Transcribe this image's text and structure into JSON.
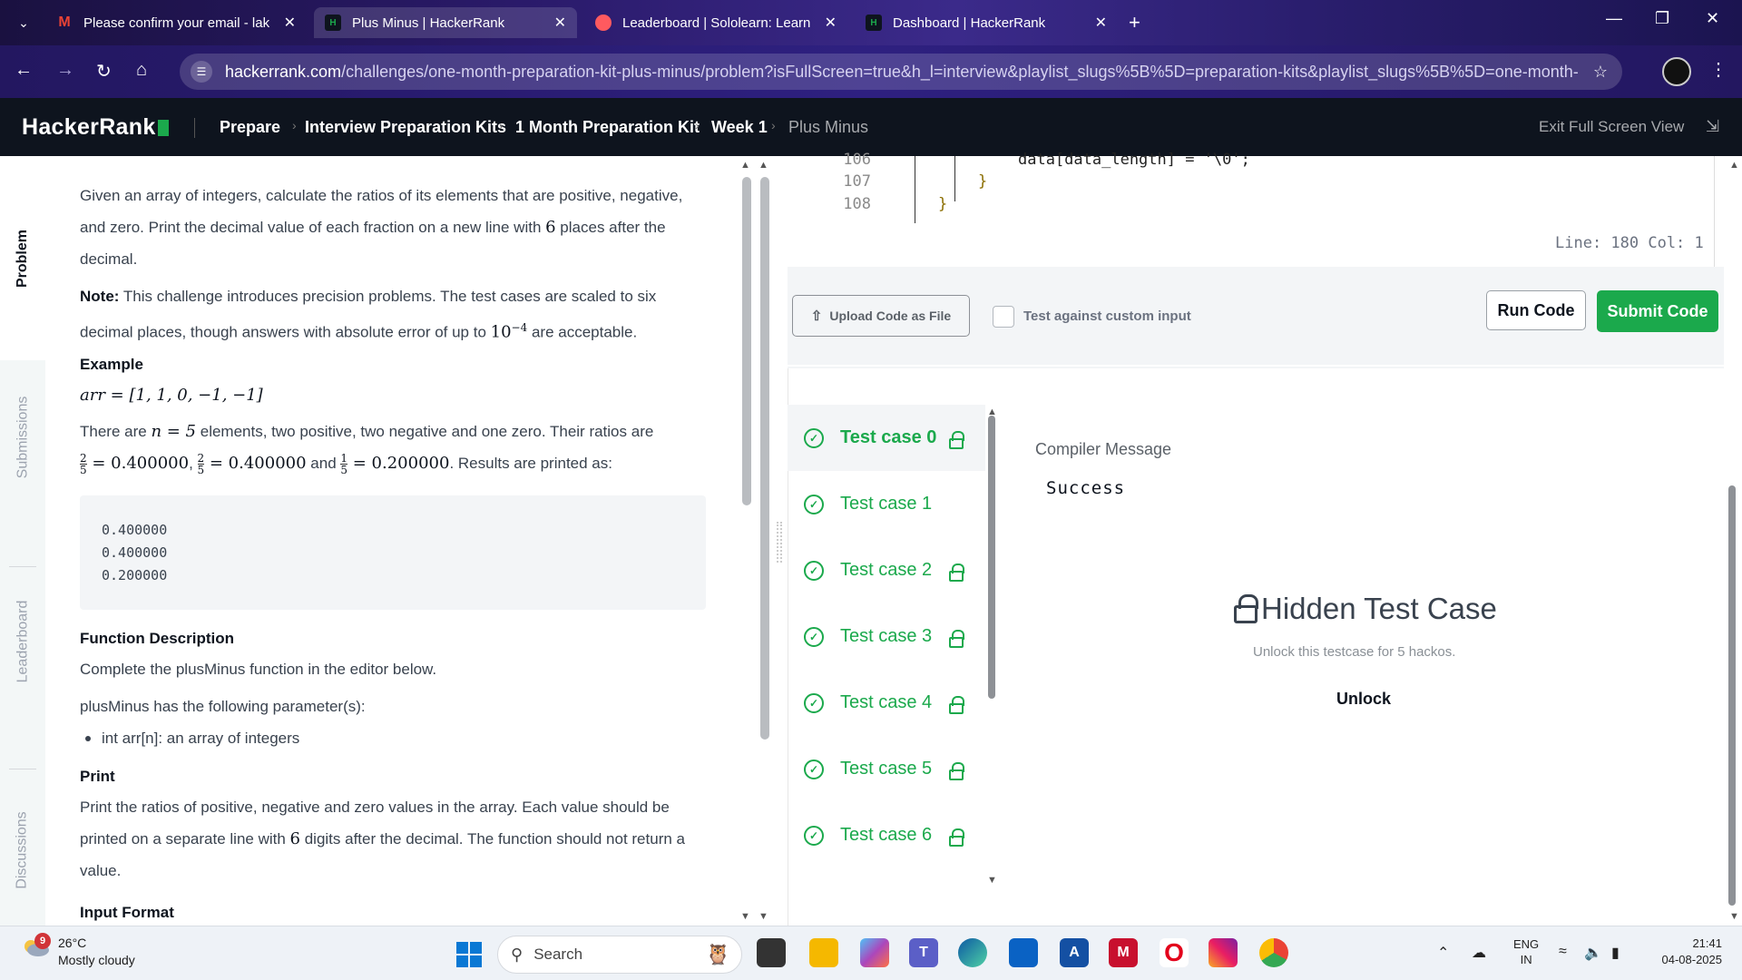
{
  "browser": {
    "tabs": [
      {
        "title": "Please confirm your email - lak",
        "favicon": "gmail"
      },
      {
        "title": "Plus Minus | HackerRank",
        "favicon": "hackerrank",
        "active": true
      },
      {
        "title": "Leaderboard | Sololearn: Learn",
        "favicon": "sololearn"
      },
      {
        "title": "Dashboard | HackerRank",
        "favicon": "hackerrank"
      }
    ],
    "url_host": "hackerrank.com",
    "url_path": "/challenges/one-month-preparation-kit-plus-minus/problem?isFullScreen=true&h_l=interview&playlist_slugs%5B%5D=preparation-kits&playlist_slugs%5B%5D=one-month-prepa..."
  },
  "header": {
    "logo": "HackerRank",
    "breadcrumb": [
      "Prepare",
      "Interview Preparation Kits",
      "1 Month Preparation Kit",
      "Week 1",
      "Plus Minus"
    ],
    "exit_full_screen": "Exit Full Screen View"
  },
  "side_tabs": [
    "Problem",
    "Submissions",
    "Leaderboard",
    "Discussions"
  ],
  "problem": {
    "intro_1": "Given an array of integers, calculate the ratios of its elements that are positive, negative,",
    "intro_2a": "and zero. Print the decimal value of each fraction on a new line with ",
    "intro_2b": "6",
    "intro_2c": " places after the",
    "intro_3": "decimal.",
    "note_label": "Note:",
    "note_1": " This challenge introduces precision problems. The test cases are scaled to six",
    "note_2a": "decimal places, though answers with absolute error of up to ",
    "note_2b": "10",
    "note_2c": "−4",
    "note_2d": " are acceptable.",
    "example_heading": "Example",
    "example_arr": "arr = [1, 1, 0, −1, −1]",
    "example_text_a": "There are ",
    "example_text_n": "n = 5",
    "example_text_b": " elements, two positive, two negative and one zero. Their ratios are",
    "ratio_1_num": "2",
    "ratio_1_den": "5",
    "ratio_1_val": " = 0.400000",
    "ratio_2_num": "2",
    "ratio_2_den": "5",
    "ratio_2_val": " = 0.400000",
    "ratio_3_num": "1",
    "ratio_3_den": "5",
    "ratio_3_val": " = 0.200000",
    "ratio_and": " and ",
    "ratio_comma": ", ",
    "ratio_tail": ". Results are printed as:",
    "output_block": "0.400000\n0.400000\n0.200000",
    "fn_desc_heading": "Function Description",
    "fn_desc": "Complete the plusMinus function in the editor below.",
    "params_intro": "plusMinus has the following parameter(s):",
    "param_1": "int arr[n]: an array of integers",
    "print_heading": "Print",
    "print_1a": "Print the ratios of positive, negative and zero values in the array. Each value should be",
    "print_2a": "printed on a separate line with ",
    "print_2b": "6",
    "print_2c": " digits after the decimal. The function should not return a",
    "print_3": "value.",
    "input_format_heading": "Input Format"
  },
  "editor": {
    "lines": [
      {
        "num": "106",
        "code": "data[data_length] = '\\0';"
      },
      {
        "num": "107",
        "code": "}"
      },
      {
        "num": "108",
        "code": "}"
      }
    ],
    "status": "Line: 180 Col: 1"
  },
  "actions": {
    "upload": "Upload Code as File",
    "custom_input": "Test against custom input",
    "run": "Run Code",
    "submit": "Submit Code"
  },
  "results": {
    "test_cases": [
      {
        "label": "Test case 0",
        "locked": true
      },
      {
        "label": "Test case 1",
        "locked": false
      },
      {
        "label": "Test case 2",
        "locked": true
      },
      {
        "label": "Test case 3",
        "locked": true
      },
      {
        "label": "Test case 4",
        "locked": true
      },
      {
        "label": "Test case 5",
        "locked": true
      },
      {
        "label": "Test case 6",
        "locked": true
      }
    ],
    "compiler_label": "Compiler Message",
    "compiler_message": "Success",
    "hidden_title": "Hidden Test Case",
    "hidden_sub": "Unlock this testcase for 5 hackos.",
    "unlock": "Unlock"
  },
  "taskbar": {
    "weather_badge": "9",
    "temperature": "26°C",
    "weather": "Mostly cloudy",
    "search": "Search",
    "lang_1": "ENG",
    "lang_2": "IN",
    "time": "21:41",
    "date": "04-08-2025"
  },
  "colors": {
    "brand_green": "#1ba94c",
    "header_bg": "#0e141e"
  }
}
